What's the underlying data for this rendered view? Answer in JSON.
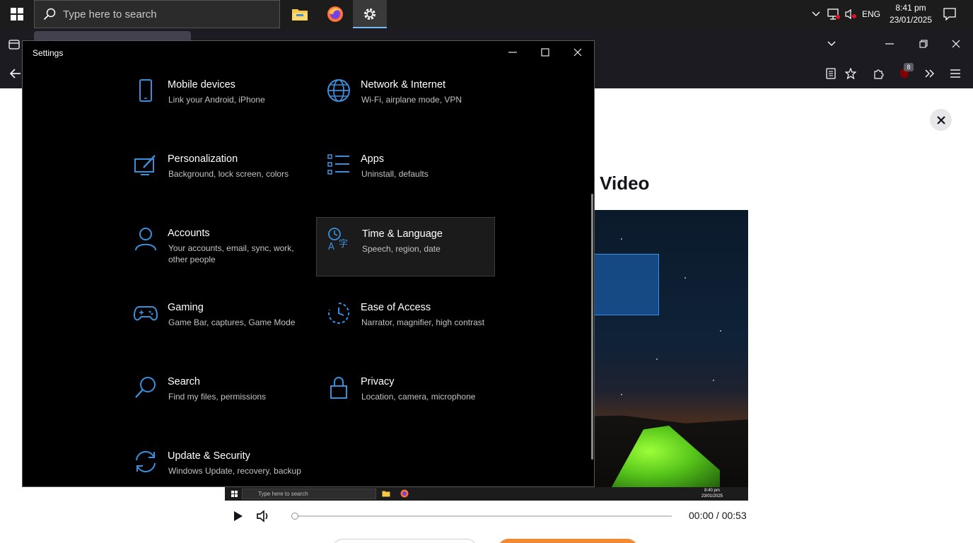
{
  "taskbar": {
    "search_placeholder": "Type here to search",
    "apps": [
      "file-explorer",
      "firefox",
      "settings"
    ],
    "language": "ENG",
    "time": "8:41 pm",
    "date": "23/01/2025"
  },
  "browser": {
    "extension_badge": "8",
    "page_heading": "d Video",
    "player": {
      "time": "00:00 / 00:53",
      "progress": 0
    },
    "video_frame": {
      "search_placeholder": "Type here to search",
      "time": "8:40 pm",
      "date": "23/01/2025"
    }
  },
  "settings": {
    "title": "Settings",
    "accent_color": "#3a8fdb",
    "categories": [
      {
        "title": "Mobile devices",
        "desc": "Link your Android, iPhone",
        "icon": "phone-icon"
      },
      {
        "title": "Network & Internet",
        "desc": "Wi-Fi, airplane mode, VPN",
        "icon": "globe-icon"
      },
      {
        "title": "Personalization",
        "desc": "Background, lock screen, colors",
        "icon": "paint-icon"
      },
      {
        "title": "Apps",
        "desc": "Uninstall, defaults",
        "icon": "apps-list-icon"
      },
      {
        "title": "Accounts",
        "desc": "Your accounts, email, sync, work, other people",
        "icon": "person-icon"
      },
      {
        "title": "Time & Language",
        "desc": "Speech, region, date",
        "icon": "time-language-icon"
      },
      {
        "title": "Gaming",
        "desc": "Game Bar, captures, Game Mode",
        "icon": "gamepad-icon"
      },
      {
        "title": "Ease of Access",
        "desc": "Narrator, magnifier, high contrast",
        "icon": "ease-of-access-icon"
      },
      {
        "title": "Search",
        "desc": "Find my files, permissions",
        "icon": "search-icon"
      },
      {
        "title": "Privacy",
        "desc": "Location, camera, microphone",
        "icon": "lock-icon"
      },
      {
        "title": "Update & Security",
        "desc": "Windows Update, recovery, backup",
        "icon": "update-icon"
      }
    ]
  }
}
